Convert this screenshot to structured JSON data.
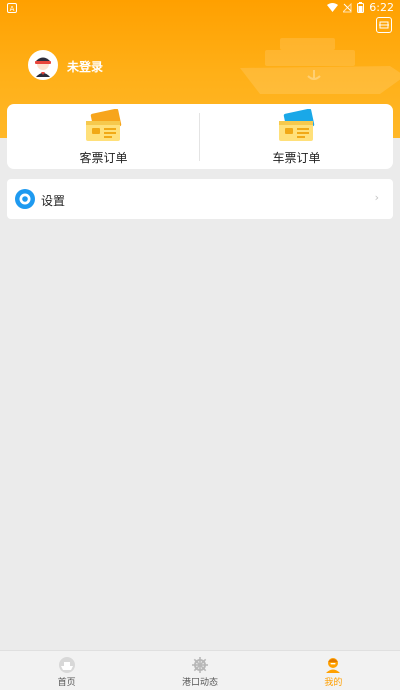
{
  "status_bar": {
    "time": "6:22"
  },
  "profile": {
    "login_status": "未登录"
  },
  "orders": [
    {
      "label": "客票订单",
      "icon": "ticket-orange-icon"
    },
    {
      "label": "车票订单",
      "icon": "ticket-blue-icon"
    }
  ],
  "settings": {
    "label": "设置",
    "chevron": "›"
  },
  "tabbar": {
    "tabs": [
      {
        "label": "首页",
        "icon": "home-ship-icon"
      },
      {
        "label": "港口动态",
        "icon": "port-helm-icon"
      },
      {
        "label": "我的",
        "icon": "profile-icon"
      }
    ],
    "active": "我的"
  },
  "colors": {
    "accent": "#ffa000",
    "active_tab": "#ff9f00",
    "settings_icon": "#1e9af0"
  }
}
